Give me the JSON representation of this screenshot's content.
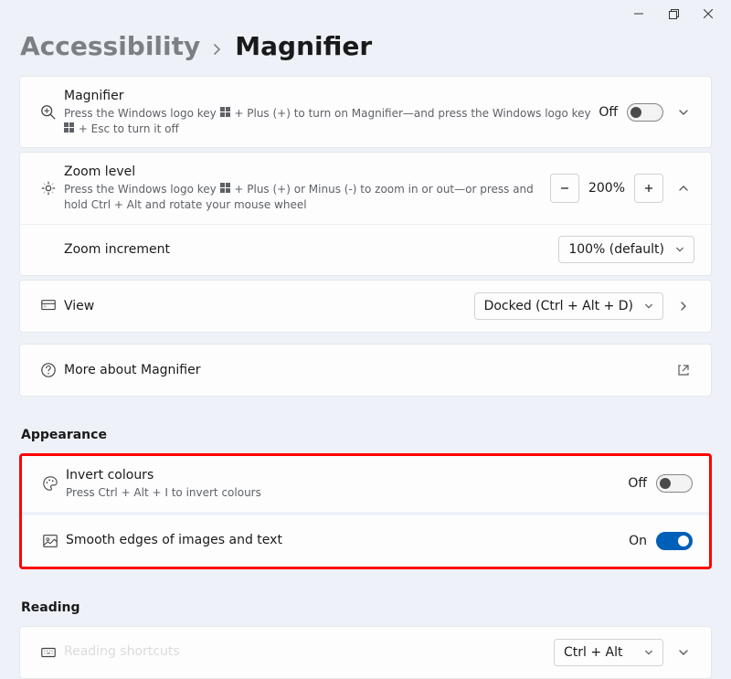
{
  "breadcrumb": {
    "parent": "Accessibility",
    "current": "Magnifier"
  },
  "magnifier": {
    "title": "Magnifier",
    "desc_a": "Press the Windows logo key ",
    "desc_b": " + Plus (+) to turn on Magnifier—and press the Windows logo key ",
    "desc_c": " + Esc to turn it off",
    "state": "Off"
  },
  "zoom_level": {
    "title": "Zoom level",
    "desc_a": "Press the Windows logo key ",
    "desc_b": " + Plus (+) or Minus (-) to zoom in or out—or press and hold Ctrl + Alt and rotate your mouse wheel",
    "value": "200%"
  },
  "zoom_increment": {
    "title": "Zoom increment",
    "value": "100% (default)"
  },
  "view": {
    "title": "View",
    "value": "Docked (Ctrl + Alt + D)"
  },
  "more": {
    "title": "More about Magnifier"
  },
  "sections": {
    "appearance": "Appearance",
    "reading": "Reading"
  },
  "invert": {
    "title": "Invert colours",
    "desc": "Press Ctrl + Alt + I to invert colours",
    "state": "Off"
  },
  "smooth": {
    "title": "Smooth edges of images and text",
    "state": "On"
  },
  "reading_shortcuts": {
    "value": "Ctrl + Alt"
  }
}
